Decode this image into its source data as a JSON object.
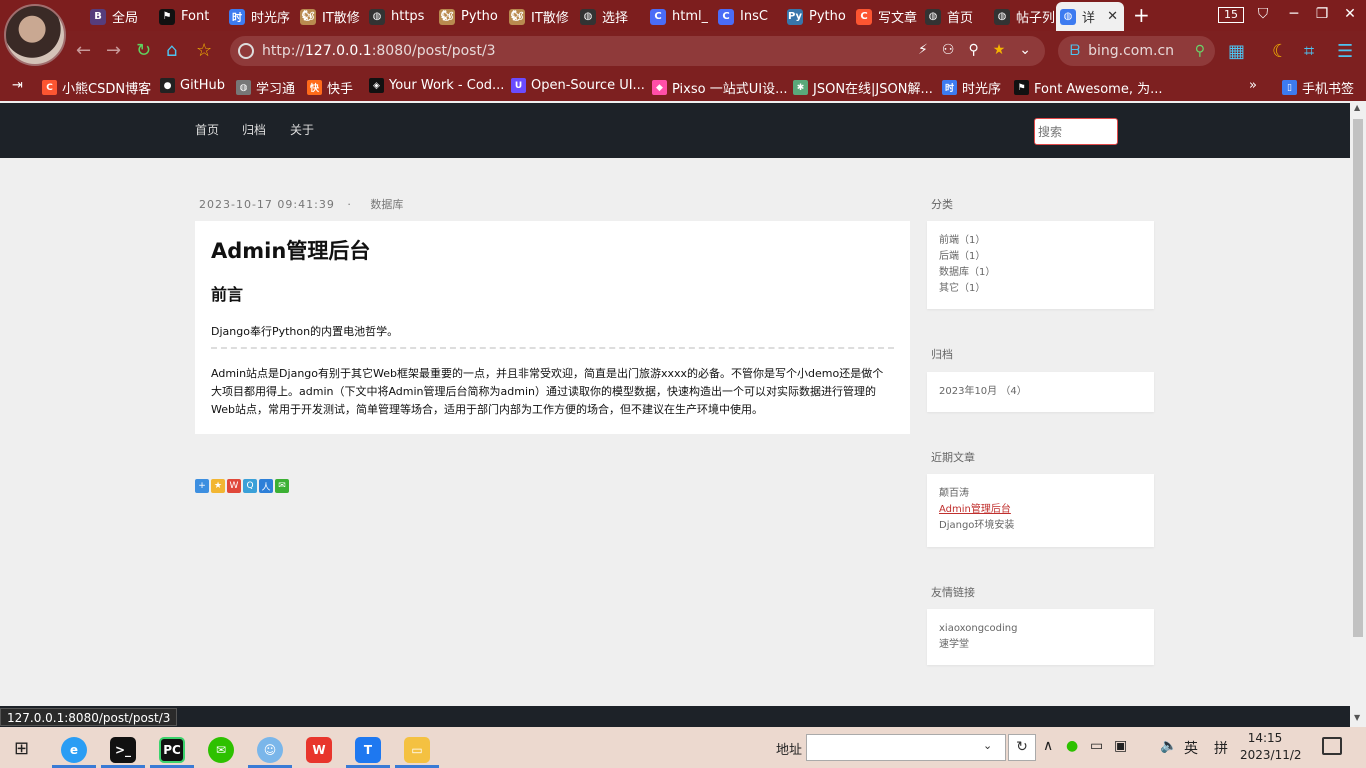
{
  "browser": {
    "tabs": [
      {
        "label": "全局",
        "icon": "B",
        "color": "#563d7c"
      },
      {
        "label": "Font",
        "icon": "flag",
        "color": "#111111"
      },
      {
        "label": "时光序",
        "icon": "时",
        "color": "#3d7bf0"
      },
      {
        "label": "IT散修",
        "icon": "squirrel",
        "color": "#b98a4f"
      },
      {
        "label": "https",
        "icon": "globe",
        "color": "#333333"
      },
      {
        "label": "Pytho",
        "icon": "squirrel",
        "color": "#b98a4f"
      },
      {
        "label": "IT散修",
        "icon": "squirrel",
        "color": "#b98a4f"
      },
      {
        "label": "选择",
        "icon": "globe",
        "color": "#333333"
      },
      {
        "label": "html_",
        "icon": "C",
        "color": "#4a6cf7"
      },
      {
        "label": "InsC",
        "icon": "C",
        "color": "#4a6cf7"
      },
      {
        "label": "Pytho",
        "icon": "py",
        "color": "#3776ab"
      },
      {
        "label": "写文章",
        "icon": "C",
        "color": "#fc5531"
      },
      {
        "label": "首页",
        "icon": "globe",
        "color": "#333333"
      },
      {
        "label": "帖子列",
        "icon": "globe",
        "color": "#333333"
      },
      {
        "label": "详",
        "icon": "globe",
        "color": "#3d7bf0",
        "active": true
      }
    ],
    "tab_count": "15",
    "url_scheme": "http://",
    "url_host": "127.0.0.1",
    "url_rest": ":8080/post/post/3",
    "search_engine": "bing.com.cn",
    "bookmarks": [
      {
        "label": "小熊CSDN博客",
        "icon": "C",
        "color": "#fc5531"
      },
      {
        "label": "GitHub",
        "icon": "github",
        "color": "#222222"
      },
      {
        "label": "学习通",
        "icon": "globe",
        "color": "#777777"
      },
      {
        "label": "快手",
        "icon": "ks",
        "color": "#ff6a1a"
      },
      {
        "label": "Your Work - Cod...",
        "icon": "cp",
        "color": "#111111"
      },
      {
        "label": "Open-Source UI...",
        "icon": "UI",
        "color": "#6a4cff"
      },
      {
        "label": "Pixso 一站式UI设...",
        "icon": "px",
        "color": "#ff4fa8"
      },
      {
        "label": "JSON在线|JSON解...",
        "icon": "js",
        "color": "#5aa87a"
      },
      {
        "label": "时光序",
        "icon": "时",
        "color": "#3d7bf0"
      },
      {
        "label": "Font Awesome, 为...",
        "icon": "flag",
        "color": "#111111"
      }
    ],
    "mobile_bookmarks": "手机书签"
  },
  "site": {
    "nav": [
      "首页",
      "归档",
      "关于"
    ],
    "search_placeholder": "搜索"
  },
  "post": {
    "date": "2023-10-17 09:41:39",
    "separator": "·",
    "category": "数据库",
    "title": "Admin管理后台",
    "heading": "前言",
    "intro": "Django奉行Python的内置电池哲学。",
    "body": "Admin站点是Django有别于其它Web框架最重要的一点，并且非常受欢迎，简直是出门旅游xxxx的必备。不管你是写个小demo还是做个大项目都用得上。admin（下文中将Admin管理后台简称为admin）通过读取你的模型数据，快速构造出一个可以对实际数据进行管理的Web站点，常用于开发测试，简单管理等场合，适用于部门内部为工作方便的场合，但不建议在生产环境中使用。"
  },
  "sidebar": {
    "categories_title": "分类",
    "categories": [
      "前端（1）",
      "后端（1）",
      "数据库（1）",
      "其它（1）"
    ],
    "archive_title": "归档",
    "archives": [
      "2023年10月 （4）"
    ],
    "recent_title": "近期文章",
    "recent": [
      {
        "label": "颠百涛",
        "active": false
      },
      {
        "label": "Admin管理后台",
        "active": true
      },
      {
        "label": "Django环境安装",
        "active": false
      }
    ],
    "links_title": "友情链接",
    "links": [
      "xiaoxongcoding",
      "速学堂"
    ]
  },
  "status_url": "127.0.0.1:8080/post/post/3",
  "taskbar": {
    "address_label": "地址",
    "ime_lang": "英",
    "ime_mode": "拼",
    "time": "14:15",
    "date": "2023/11/2"
  }
}
